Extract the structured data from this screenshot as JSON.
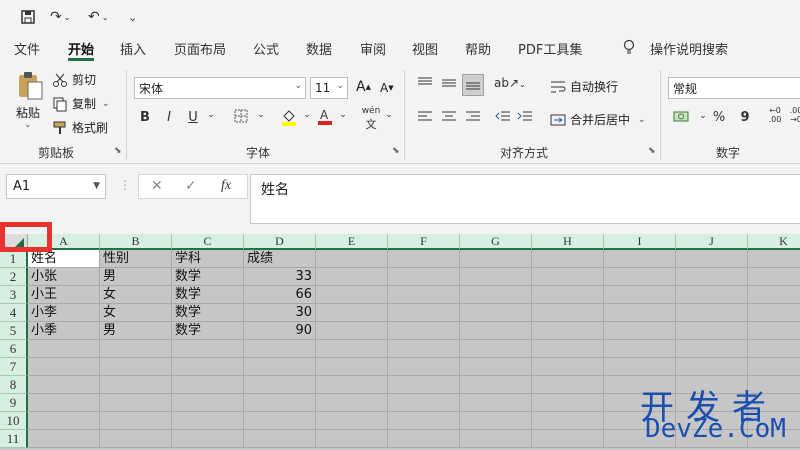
{
  "tabs": [
    "文件",
    "开始",
    "插入",
    "页面布局",
    "公式",
    "数据",
    "审阅",
    "视图",
    "帮助",
    "PDF工具集"
  ],
  "tell_me": "操作说明搜索",
  "clipboard": {
    "paste": "粘贴",
    "cut": "剪切",
    "copy": "复制",
    "format_painter": "格式刷",
    "group": "剪贴板"
  },
  "font": {
    "name": "宋体",
    "size": "11",
    "bold": "B",
    "italic": "I",
    "underline": "U",
    "group": "字体",
    "phonetic": "wén"
  },
  "alignment": {
    "wrap": "自动换行",
    "merge": "合并后居中",
    "group": "对齐方式"
  },
  "number": {
    "format": "常规",
    "percent": "%",
    "comma": "9",
    "group": "数字"
  },
  "namebox": "A1",
  "formula": "姓名",
  "fx": "fx",
  "columns": [
    "A",
    "B",
    "C",
    "D",
    "E",
    "F",
    "G",
    "H",
    "I",
    "J",
    "K"
  ],
  "rows": [
    "1",
    "2",
    "3",
    "4",
    "5",
    "6",
    "7",
    "8",
    "9",
    "10",
    "11"
  ],
  "cells": [
    [
      "姓名",
      "性别",
      "学科",
      "成绩"
    ],
    [
      "小张",
      "男",
      "数学",
      "33"
    ],
    [
      "小王",
      "女",
      "数学",
      "66"
    ],
    [
      "小李",
      "女",
      "数学",
      "30"
    ],
    [
      "小季",
      "男",
      "数学",
      "90"
    ]
  ],
  "watermark": {
    "line1": "开发者",
    "line2": "DevZe.CoM"
  },
  "colors": {
    "accent": "#217346",
    "highlight": "#e8322f",
    "selection": "#c6c6c6"
  }
}
